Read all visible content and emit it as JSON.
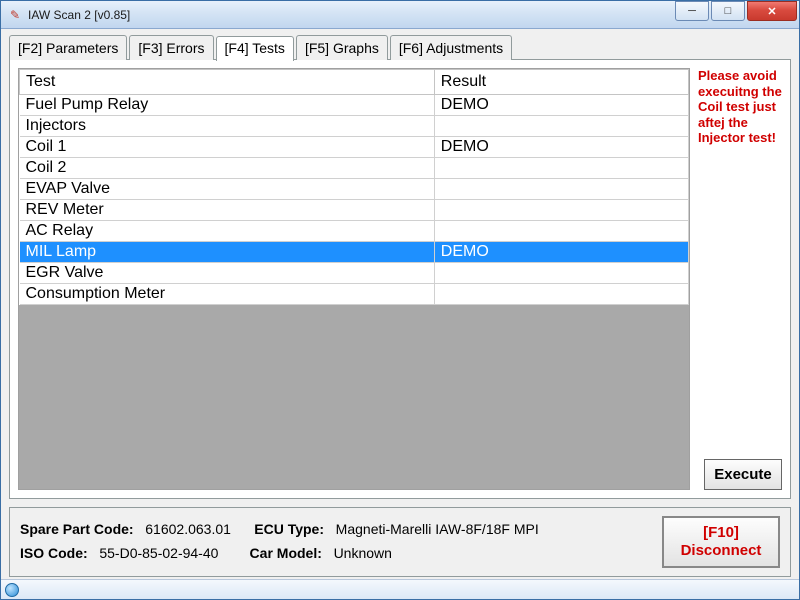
{
  "window": {
    "title": "IAW Scan 2 [v0.85]"
  },
  "tabs": [
    {
      "label": "[F2] Parameters"
    },
    {
      "label": "[F3] Errors"
    },
    {
      "label": "[F4] Tests",
      "active": true
    },
    {
      "label": "[F5] Graphs"
    },
    {
      "label": "[F6] Adjustments"
    }
  ],
  "tests_table": {
    "headers": {
      "test": "Test",
      "result": "Result"
    },
    "rows": [
      {
        "test": "Fuel Pump Relay",
        "result": "DEMO",
        "selected": false
      },
      {
        "test": "Injectors",
        "result": "",
        "selected": false
      },
      {
        "test": "Coil 1",
        "result": "DEMO",
        "selected": false
      },
      {
        "test": "Coil 2",
        "result": "",
        "selected": false
      },
      {
        "test": "EVAP Valve",
        "result": "",
        "selected": false
      },
      {
        "test": "REV Meter",
        "result": "",
        "selected": false
      },
      {
        "test": "AC Relay",
        "result": "",
        "selected": false
      },
      {
        "test": "MIL Lamp",
        "result": "DEMO",
        "selected": true
      },
      {
        "test": "EGR Valve",
        "result": "",
        "selected": false
      },
      {
        "test": "Consumption Meter",
        "result": "",
        "selected": false
      }
    ]
  },
  "warning_text": "Please avoid execuitng the Coil test just aftej the Injector test!",
  "buttons": {
    "execute": "Execute",
    "disconnect_line1": "[F10]",
    "disconnect_line2": "Disconnect"
  },
  "footer": {
    "spare_part_label": "Spare Part Code:",
    "spare_part_value": "61602.063.01",
    "ecu_type_label": "ECU Type:",
    "ecu_type_value": "Magneti-Marelli IAW-8F/18F MPI",
    "iso_code_label": "ISO Code:",
    "iso_code_value": "55-D0-85-02-94-40",
    "car_model_label": "Car Model:",
    "car_model_value": "Unknown"
  }
}
